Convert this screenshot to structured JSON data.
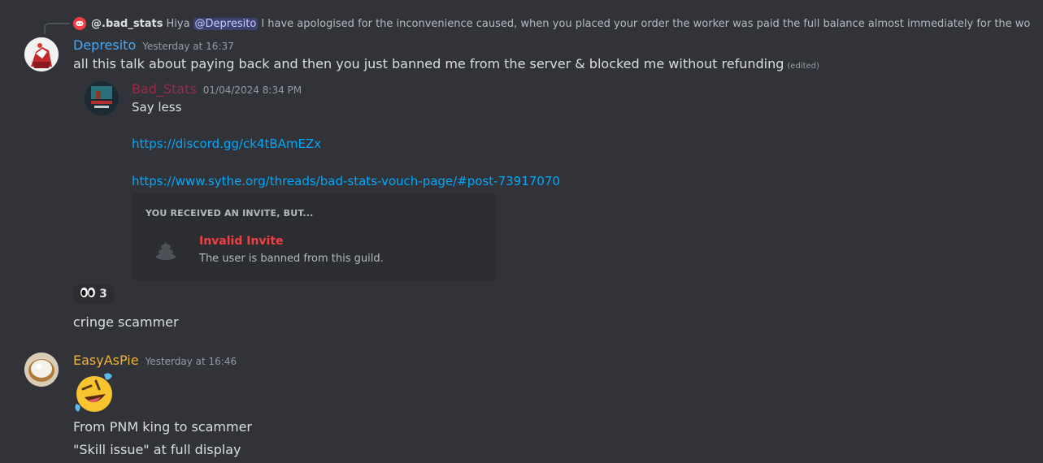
{
  "reply": {
    "author": "@.bad_stats",
    "text_before": "Hiya",
    "mention": "@Depresito",
    "text_after": "I have apologised for the inconvenience caused, when you placed your order the worker was paid the full balance almost immediately for the wo"
  },
  "messages": [
    {
      "author": "Depresito",
      "author_color": "#4aa8f0",
      "timestamp": "Yesterday at 16:37",
      "text": "all this talk about paying back and then you just banned me from the server & blocked me without refunding",
      "edited": "(edited)"
    },
    {
      "author": "EasyAsPie",
      "author_color": "#f0b232",
      "timestamp": "Yesterday at 16:46",
      "lines": [
        "From PNM king to scammer",
        "\"Skill issue\" at full display"
      ]
    }
  ],
  "quoted": {
    "author": "Bad_Stats",
    "author_color": "#9c2a4a",
    "timestamp": "01/04/2024 8:34 PM",
    "text": "Say less",
    "link1": "https://discord.gg/ck4tBAmEZx",
    "link2": "https://www.sythe.org/threads/bad-stats-vouch-page/#post-73917070"
  },
  "embed": {
    "header": "YOU RECEIVED AN INVITE, BUT...",
    "title": "Invalid Invite",
    "subtitle": "The user is banned from this guild."
  },
  "reaction": {
    "emoji": "👀",
    "count": "3"
  },
  "followup": "cringe scammer"
}
